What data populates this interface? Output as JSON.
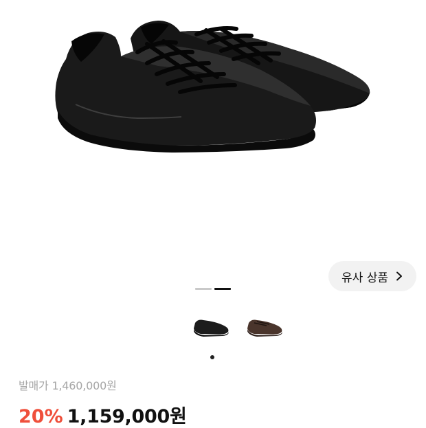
{
  "product": {
    "image": {
      "icon": "black-leather-sneakers-photo",
      "colorway": "black"
    },
    "thumbnails": [
      {
        "icon": "black-sneaker-thumbnail",
        "color": "#1c1c1c"
      },
      {
        "icon": "brown-sneaker-thumbnail",
        "color": "#4a352c"
      }
    ],
    "gallery": {
      "total_pages": 2,
      "current_page": 2
    }
  },
  "similar_products": {
    "label": "유사 상품",
    "icon": "chevron-right-icon"
  },
  "price": {
    "original_label": "발매가 1,460,000원",
    "discount_percent": "20%",
    "sale_price": "1,159,000원"
  },
  "colors": {
    "discount": "#ef4f3b",
    "text_primary": "#111111",
    "text_muted": "#a6a6a6",
    "button_bg": "#f2f2f2"
  }
}
